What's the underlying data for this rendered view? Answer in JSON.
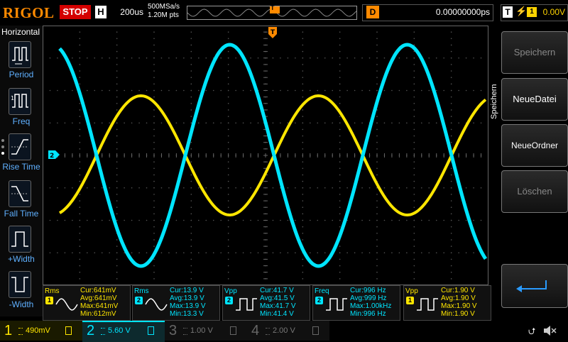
{
  "top": {
    "brand": "RIGOL",
    "run_state": "STOP",
    "horizontal_label": "H",
    "timebase": "200us",
    "sample_rate": "500MSa/s",
    "memory_depth": "1.20M pts",
    "trigger_position_marker": "T",
    "delay_label": "D",
    "delay_value": "0.00000000ps",
    "trigger_label": "T",
    "trigger_source": "1",
    "trigger_level": "0.00V"
  },
  "left_menu": {
    "title": "Horizontal",
    "items": [
      {
        "label": "Period",
        "icon": "period-icon"
      },
      {
        "label": "Freq",
        "icon": "frequency-icon"
      },
      {
        "label": "Rise Time",
        "icon": "rise-time-icon"
      },
      {
        "label": "Fall Time",
        "icon": "fall-time-icon"
      },
      {
        "label": "+Width",
        "icon": "positive-width-icon"
      },
      {
        "label": "-Width",
        "icon": "negative-width-icon"
      }
    ]
  },
  "right_menu": {
    "title": "Speichern",
    "buttons": [
      "Speichern",
      "NeueDatei",
      "NeueOrdner",
      "Löschen"
    ],
    "enter_icon": "enter-arrow-icon"
  },
  "markers": {
    "ch2_offset": "2",
    "trigger_level": "T",
    "trigger_top": "T"
  },
  "measurements": [
    {
      "name": "Rms",
      "source": "1",
      "color": "#ffe600",
      "icon": "sine-wave-icon",
      "cur": "Cur:641mV",
      "avg": "Avg:641mV",
      "max": "Max:641mV",
      "min": "Min:612mV"
    },
    {
      "name": "Rms",
      "source": "2",
      "color": "#00e5ff",
      "icon": "sine-wave-icon",
      "cur": "Cur:13.9 V",
      "avg": "Avg:13.9 V",
      "max": "Max:13.9 V",
      "min": "Min:13.3 V"
    },
    {
      "name": "Vpp",
      "source": "2",
      "color": "#00e5ff",
      "icon": "pulse-vpp-icon",
      "cur": "Cur:41.7 V",
      "avg": "Avg:41.5 V",
      "max": "Max:41.7 V",
      "min": "Min:41.4 V"
    },
    {
      "name": "Freq",
      "source": "2",
      "color": "#00e5ff",
      "icon": "pulse-freq-icon",
      "cur": "Cur:996 Hz",
      "avg": "Avg:999 Hz",
      "max": "Max:1.00kHz",
      "min": "Min:996 Hz"
    },
    {
      "name": "Vpp",
      "source": "1",
      "color": "#ffe600",
      "icon": "pulse-vpp-icon",
      "cur": "Cur:1.90 V",
      "avg": "Avg:1.90 V",
      "max": "Max:1.90 V",
      "min": "Min:1.90 V"
    }
  ],
  "channels": [
    {
      "num": "1",
      "scale": "490mV",
      "color": "#ffe600",
      "active": true
    },
    {
      "num": "2",
      "scale": "5.60 V",
      "color": "#00e5ff",
      "active": true
    },
    {
      "num": "3",
      "scale": "1.00 V",
      "color": "#9b3bd6",
      "active": false
    },
    {
      "num": "4",
      "scale": "2.00 V",
      "color": "#2a6cff",
      "active": false
    }
  ],
  "colors": {
    "ch1": "#ffe600",
    "ch2": "#00e5ff",
    "trigger": "#ff8a00",
    "grid": "#555555",
    "accent": "#5fb0ff"
  }
}
